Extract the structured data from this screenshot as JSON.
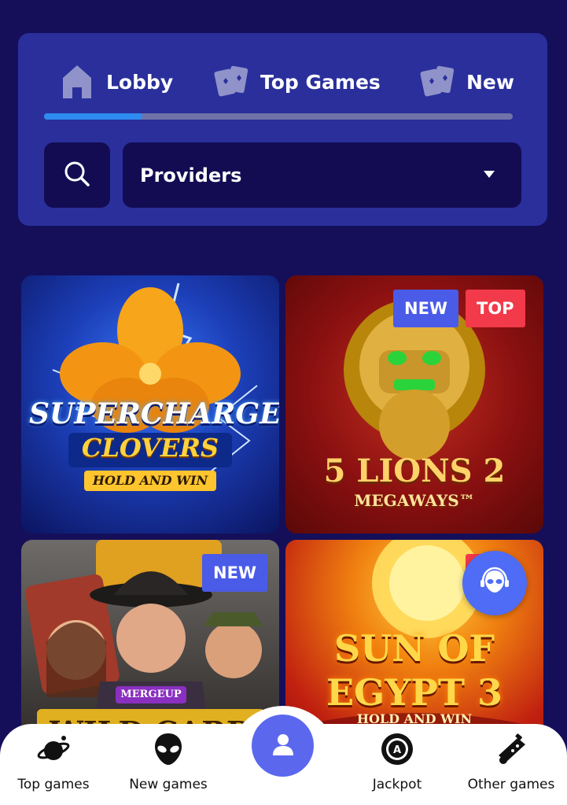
{
  "tabs": {
    "items": [
      {
        "label": "Lobby",
        "icon": "home-icon"
      },
      {
        "label": "Top Games",
        "icon": "cards-icon"
      },
      {
        "label": "New",
        "icon": "cards-icon"
      }
    ],
    "scroll_progress": 0.21
  },
  "filters": {
    "search_icon": "search-icon",
    "providers_label": "Providers"
  },
  "games": [
    {
      "title_lines": [
        "SUPERCHARGED",
        "CLOVERS",
        "HOLD AND WIN"
      ],
      "badges": []
    },
    {
      "title_lines": [
        "5 LIONS 2",
        "MEGAWAYS™"
      ],
      "badges": [
        "NEW",
        "TOP"
      ]
    },
    {
      "title_lines": [
        "MERGEUP",
        "WILD CARD"
      ],
      "badges": [
        "NEW"
      ]
    },
    {
      "title_lines": [
        "SUN OF EGYPT 3",
        "HOLD AND WIN"
      ],
      "badges": []
    }
  ],
  "bottom_nav": {
    "items": [
      {
        "label": "Top games",
        "icon": "planet-icon"
      },
      {
        "label": "New games",
        "icon": "alien-icon"
      },
      {
        "label": "Jackpot",
        "icon": "chip-icon"
      },
      {
        "label": "Other games",
        "icon": "gamepad-icon"
      }
    ],
    "center_icon": "user-icon"
  },
  "colors": {
    "background": "#150f5a",
    "card": "#2a2f9c",
    "accent": "#2e8cf0",
    "badge_new": "#4a5be8",
    "badge_top": "#f23a4a"
  }
}
